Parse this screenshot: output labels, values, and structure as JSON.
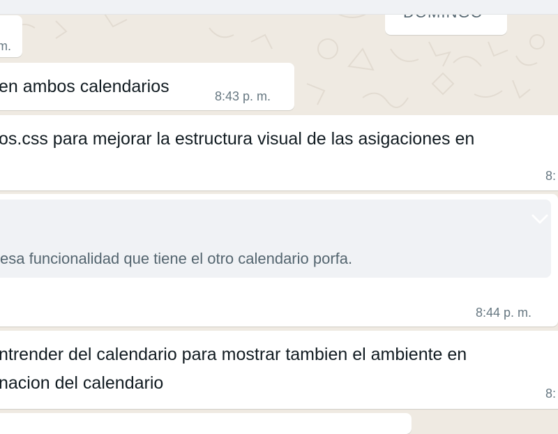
{
  "date_chip": {
    "label": "DOMINGO"
  },
  "messages": [
    {
      "text": "",
      "time": "m."
    },
    {
      "text": "en ambos calendarios",
      "time": "8:43 p. m."
    },
    {
      "text": "os.css para mejorar la estructura visual de las asigaciones en",
      "time": "8:"
    },
    {
      "quote": "esa funcionalidad que tiene el otro calendario porfa.",
      "text": "",
      "time": "8:44 p. m."
    },
    {
      "text_lines": [
        "ntrender del calendario para mostrar tambien el ambiente en",
        "nacion del calendario"
      ],
      "time": "8:"
    }
  ],
  "colors": {
    "chat_background": "#efeae2",
    "bubble": "#ffffff",
    "quote_background": "#f0f2f5",
    "meta_text": "#667781"
  },
  "icons": {
    "quote_menu": "chevron-down-icon"
  }
}
